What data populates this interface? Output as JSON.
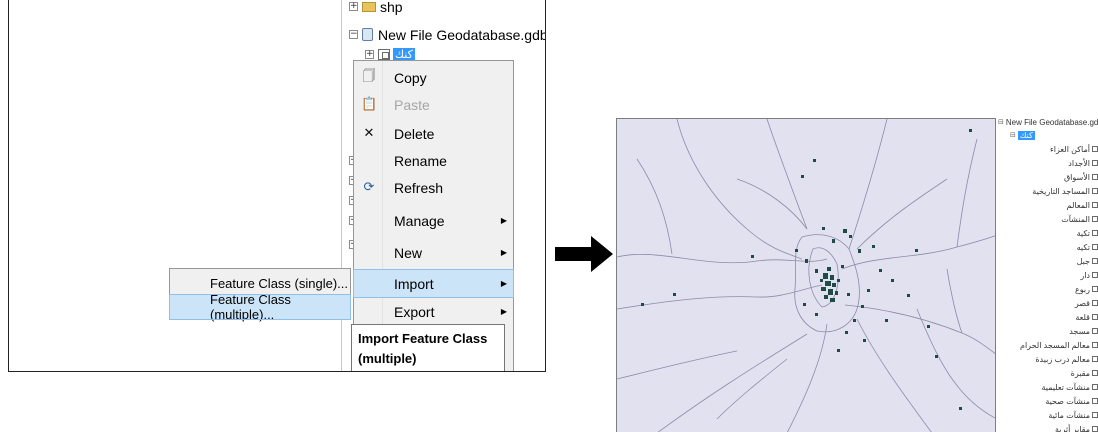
{
  "catalog": {
    "items": [
      {
        "label": "shp",
        "icon": "folder-icon"
      },
      {
        "label": "New File Geodatabase.gdb",
        "icon": "geodatabase-icon"
      },
      {
        "label": "كنك",
        "icon": "feature-dataset-icon"
      }
    ]
  },
  "context_menu": {
    "items": [
      {
        "label": "Copy",
        "icon": "copy-icon",
        "enabled": true
      },
      {
        "label": "Paste",
        "icon": "paste-icon",
        "enabled": false
      },
      {
        "label": "Delete",
        "icon": "delete-icon",
        "enabled": true
      },
      {
        "label": "Rename",
        "icon": "",
        "enabled": true
      },
      {
        "label": "Refresh",
        "icon": "refresh-icon",
        "enabled": true
      },
      {
        "label": "Manage",
        "icon": "",
        "submenu": true
      },
      {
        "label": "New",
        "icon": "",
        "submenu": true
      },
      {
        "label": "Import",
        "icon": "",
        "submenu": true,
        "highlighted": true
      },
      {
        "label": "Export",
        "icon": "",
        "submenu": true
      }
    ]
  },
  "import_submenu": {
    "items": [
      {
        "label": "Feature Class (single)..."
      },
      {
        "label": "Feature Class (multiple)...",
        "highlighted": true
      }
    ]
  },
  "tooltip": {
    "line1": "Import Feature Class",
    "line2": "(multiple)"
  },
  "result_toc": {
    "gdb_label": "New File Geodatabase.gdb",
    "dataset_label": "كنك",
    "layers": [
      "أماكن العزاء",
      "الأجداد",
      "الأسواق",
      "المساجد التاريخية",
      "المعالم",
      "المنشآت",
      "تكية",
      "تكيه",
      "جبل",
      "دار",
      "ربوع",
      "قصر",
      "قلعة",
      "مسجد",
      "معالم المسجد الحرام",
      "معالم درب زبيدة",
      "مقبرة",
      "منشآت تعليمية",
      "منشآت صحية",
      "منشآت مائية",
      "مقابر أثرية"
    ]
  },
  "colors": {
    "selection": "#3399ff",
    "menu_highlight": "#cce4f7",
    "map_background": "#e1e1f0",
    "map_points": "#1f4a45"
  }
}
